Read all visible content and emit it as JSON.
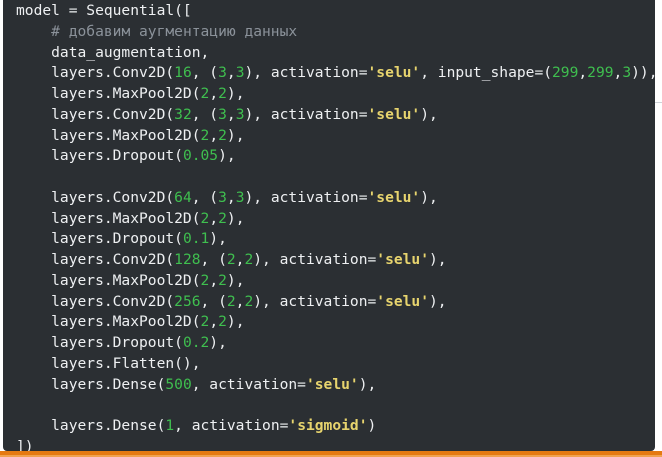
{
  "code_lines": [
    [
      {
        "t": "model = Sequential([",
        "c": ""
      }
    ],
    [
      {
        "t": "    ",
        "c": ""
      },
      {
        "t": "# добавим аугментацию данных",
        "c": "cm"
      }
    ],
    [
      {
        "t": "    data_augmentation,",
        "c": ""
      }
    ],
    [
      {
        "t": "    layers.Conv2D(",
        "c": ""
      },
      {
        "t": "16",
        "c": "num"
      },
      {
        "t": ", (",
        "c": ""
      },
      {
        "t": "3",
        "c": "num"
      },
      {
        "t": ",",
        "c": ""
      },
      {
        "t": "3",
        "c": "num"
      },
      {
        "t": "), activation=",
        "c": ""
      },
      {
        "t": "'selu'",
        "c": "str"
      },
      {
        "t": ", input_shape=(",
        "c": ""
      },
      {
        "t": "299",
        "c": "num"
      },
      {
        "t": ",",
        "c": ""
      },
      {
        "t": "299",
        "c": "num"
      },
      {
        "t": ",",
        "c": ""
      },
      {
        "t": "3",
        "c": "num"
      },
      {
        "t": ")),",
        "c": ""
      }
    ],
    [
      {
        "t": "    layers.MaxPool2D(",
        "c": ""
      },
      {
        "t": "2",
        "c": "num"
      },
      {
        "t": ",",
        "c": ""
      },
      {
        "t": "2",
        "c": "num"
      },
      {
        "t": "),",
        "c": ""
      }
    ],
    [
      {
        "t": "    layers.Conv2D(",
        "c": ""
      },
      {
        "t": "32",
        "c": "num"
      },
      {
        "t": ", (",
        "c": ""
      },
      {
        "t": "3",
        "c": "num"
      },
      {
        "t": ",",
        "c": ""
      },
      {
        "t": "3",
        "c": "num"
      },
      {
        "t": "), activation=",
        "c": ""
      },
      {
        "t": "'selu'",
        "c": "str"
      },
      {
        "t": "),",
        "c": ""
      }
    ],
    [
      {
        "t": "    layers.MaxPool2D(",
        "c": ""
      },
      {
        "t": "2",
        "c": "num"
      },
      {
        "t": ",",
        "c": ""
      },
      {
        "t": "2",
        "c": "num"
      },
      {
        "t": "),",
        "c": ""
      }
    ],
    [
      {
        "t": "    layers.Dropout(",
        "c": ""
      },
      {
        "t": "0.05",
        "c": "num"
      },
      {
        "t": "),",
        "c": ""
      }
    ],
    [
      {
        "t": "",
        "c": ""
      }
    ],
    [
      {
        "t": "    layers.Conv2D(",
        "c": ""
      },
      {
        "t": "64",
        "c": "num"
      },
      {
        "t": ", (",
        "c": ""
      },
      {
        "t": "3",
        "c": "num"
      },
      {
        "t": ",",
        "c": ""
      },
      {
        "t": "3",
        "c": "num"
      },
      {
        "t": "), activation=",
        "c": ""
      },
      {
        "t": "'selu'",
        "c": "str"
      },
      {
        "t": "),",
        "c": ""
      }
    ],
    [
      {
        "t": "    layers.MaxPool2D(",
        "c": ""
      },
      {
        "t": "2",
        "c": "num"
      },
      {
        "t": ",",
        "c": ""
      },
      {
        "t": "2",
        "c": "num"
      },
      {
        "t": "),",
        "c": ""
      }
    ],
    [
      {
        "t": "    layers.Dropout(",
        "c": ""
      },
      {
        "t": "0.1",
        "c": "num"
      },
      {
        "t": "),",
        "c": ""
      }
    ],
    [
      {
        "t": "    layers.Conv2D(",
        "c": ""
      },
      {
        "t": "128",
        "c": "num"
      },
      {
        "t": ", (",
        "c": ""
      },
      {
        "t": "2",
        "c": "num"
      },
      {
        "t": ",",
        "c": ""
      },
      {
        "t": "2",
        "c": "num"
      },
      {
        "t": "), activation=",
        "c": ""
      },
      {
        "t": "'selu'",
        "c": "str"
      },
      {
        "t": "),",
        "c": ""
      }
    ],
    [
      {
        "t": "    layers.MaxPool2D(",
        "c": ""
      },
      {
        "t": "2",
        "c": "num"
      },
      {
        "t": ",",
        "c": ""
      },
      {
        "t": "2",
        "c": "num"
      },
      {
        "t": "),",
        "c": ""
      }
    ],
    [
      {
        "t": "    layers.Conv2D(",
        "c": ""
      },
      {
        "t": "256",
        "c": "num"
      },
      {
        "t": ", (",
        "c": ""
      },
      {
        "t": "2",
        "c": "num"
      },
      {
        "t": ",",
        "c": ""
      },
      {
        "t": "2",
        "c": "num"
      },
      {
        "t": "), activation=",
        "c": ""
      },
      {
        "t": "'selu'",
        "c": "str"
      },
      {
        "t": "),",
        "c": ""
      }
    ],
    [
      {
        "t": "    layers.MaxPool2D(",
        "c": ""
      },
      {
        "t": "2",
        "c": "num"
      },
      {
        "t": ",",
        "c": ""
      },
      {
        "t": "2",
        "c": "num"
      },
      {
        "t": "),",
        "c": ""
      }
    ],
    [
      {
        "t": "    layers.Dropout(",
        "c": ""
      },
      {
        "t": "0.2",
        "c": "num"
      },
      {
        "t": "),",
        "c": ""
      }
    ],
    [
      {
        "t": "    layers.Flatten(),",
        "c": ""
      }
    ],
    [
      {
        "t": "    layers.Dense(",
        "c": ""
      },
      {
        "t": "500",
        "c": "num"
      },
      {
        "t": ", activation=",
        "c": ""
      },
      {
        "t": "'selu'",
        "c": "str"
      },
      {
        "t": "),",
        "c": ""
      }
    ],
    [
      {
        "t": "",
        "c": ""
      }
    ],
    [
      {
        "t": "    layers.Dense(",
        "c": ""
      },
      {
        "t": "1",
        "c": "num"
      },
      {
        "t": ", activation=",
        "c": ""
      },
      {
        "t": "'sigmoid'",
        "c": "str"
      },
      {
        "t": ")",
        "c": ""
      }
    ],
    [
      {
        "t": "])",
        "c": ""
      }
    ]
  ],
  "colors": {
    "background": "#2b2f33",
    "text": "#eef0f2",
    "comment": "#8b929a",
    "number": "#3fbf4f",
    "string": "#e7d46e",
    "accent_bar": "#e57a12"
  }
}
